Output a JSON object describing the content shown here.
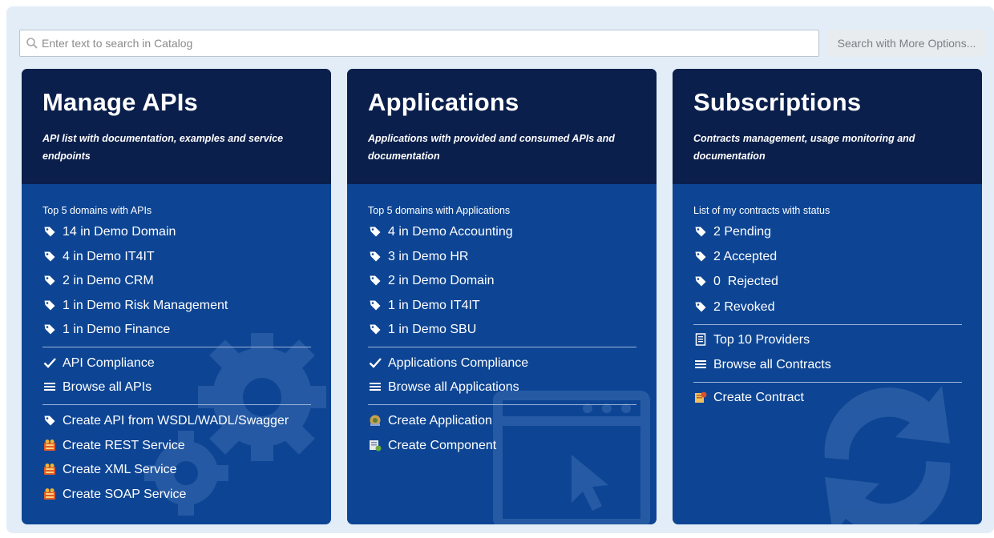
{
  "search": {
    "placeholder": "Enter text to search in Catalog",
    "more_options_label": "Search with More Options..."
  },
  "colors": {
    "page_bg": "#e2edf7",
    "card_header": "#0b1f4c",
    "card_body": "#0d4594"
  },
  "cards": [
    {
      "title": "Manage APIs",
      "description": "API list with documentation, examples and service endpoints",
      "background_icon": "gear-icon",
      "section_label": "Top 5 domains with APIs",
      "domains": [
        {
          "label": "14 in Demo Domain",
          "icon": "tag-icon"
        },
        {
          "label": "4 in Demo IT4IT",
          "icon": "tag-icon"
        },
        {
          "label": "2 in Demo CRM",
          "icon": "tag-icon"
        },
        {
          "label": "1 in Demo Risk Management",
          "icon": "tag-icon"
        },
        {
          "label": "1 in Demo Finance",
          "icon": "tag-icon"
        }
      ],
      "links": [
        {
          "label": "API Compliance",
          "icon": "checkmark-icon"
        },
        {
          "label": "Browse all APIs",
          "icon": "list-icon"
        }
      ],
      "actions": [
        {
          "label": "Create API from WSDL/WADL/Swagger",
          "icon": "tag-icon"
        },
        {
          "label": "Create REST Service",
          "icon": "service-icon"
        },
        {
          "label": "Create XML Service",
          "icon": "service-icon"
        },
        {
          "label": "Create SOAP Service",
          "icon": "service-icon"
        }
      ]
    },
    {
      "title": "Applications",
      "description": "Applications with provided and consumed APIs and documentation",
      "background_icon": "app-window-icon",
      "section_label": "Top 5 domains with Applications",
      "domains": [
        {
          "label": "4 in Demo Accounting",
          "icon": "tag-icon"
        },
        {
          "label": "3 in Demo HR",
          "icon": "tag-icon"
        },
        {
          "label": "2 in Demo Domain",
          "icon": "tag-icon"
        },
        {
          "label": "1 in Demo IT4IT",
          "icon": "tag-icon"
        },
        {
          "label": "1 in Demo SBU",
          "icon": "tag-icon"
        }
      ],
      "links": [
        {
          "label": "Applications Compliance",
          "icon": "checkmark-icon"
        },
        {
          "label": "Browse all Applications",
          "icon": "list-icon"
        }
      ],
      "actions": [
        {
          "label": "Create Application",
          "icon": "application-icon"
        },
        {
          "label": "Create Component",
          "icon": "component-icon"
        }
      ]
    },
    {
      "title": "Subscriptions",
      "description": "Contracts management, usage monitoring and documentation",
      "background_icon": "refresh-arrows-icon",
      "section_label": "List of my contracts with status",
      "contracts": [
        {
          "label": "2 Pending",
          "icon": "tag-icon"
        },
        {
          "label": "2 Accepted",
          "icon": "tag-icon"
        },
        {
          "label": "0  Rejected",
          "icon": "tag-icon"
        },
        {
          "label": "2 Revoked",
          "icon": "tag-icon"
        }
      ],
      "links": [
        {
          "label": "Top 10 Providers",
          "icon": "document-icon"
        },
        {
          "label": "Browse all Contracts",
          "icon": "list-icon"
        }
      ],
      "actions": [
        {
          "label": "Create Contract",
          "icon": "contract-icon"
        }
      ]
    }
  ]
}
